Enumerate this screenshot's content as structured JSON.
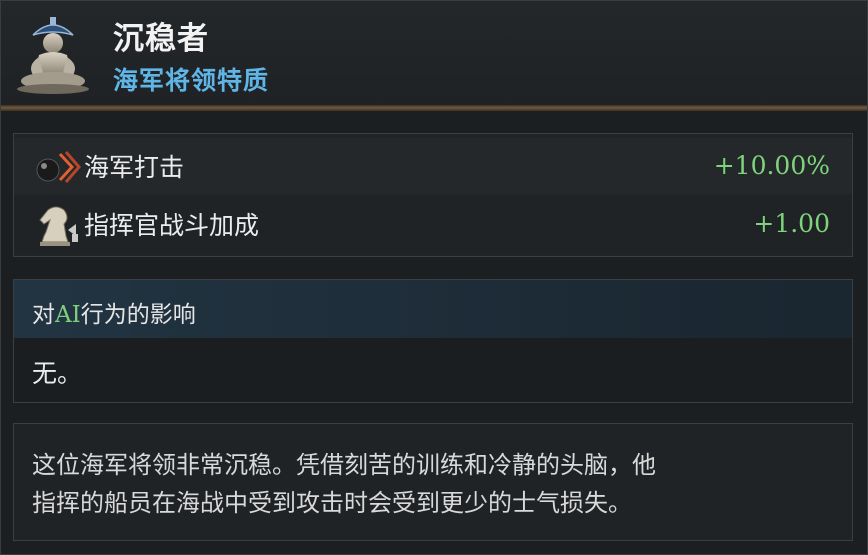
{
  "trait": {
    "title": "沉稳者",
    "category": "海军将领特质",
    "portrait_icon": "meditating-admiral-icon"
  },
  "modifiers": [
    {
      "icon": "cannonball-strike-icon",
      "name": "海军打击",
      "value": "+10.00%"
    },
    {
      "icon": "knight-chess-piece-icon",
      "name": "指挥官战斗加成",
      "value": "+1.00"
    }
  ],
  "ai_section": {
    "label_prefix": "对",
    "label_highlight": "AI",
    "label_suffix": "行为的影响",
    "value": "无。"
  },
  "description": {
    "line1": "这位海军将领非常沉稳。凭借刻苦的训练和冷静的头脑，他",
    "line2": "指挥的船员在海战中受到攻击时会受到更少的士气损失。"
  },
  "colors": {
    "subtitle": "#5fb6e6",
    "positive_value": "#7ed47b",
    "divider": "#6e5a40"
  }
}
